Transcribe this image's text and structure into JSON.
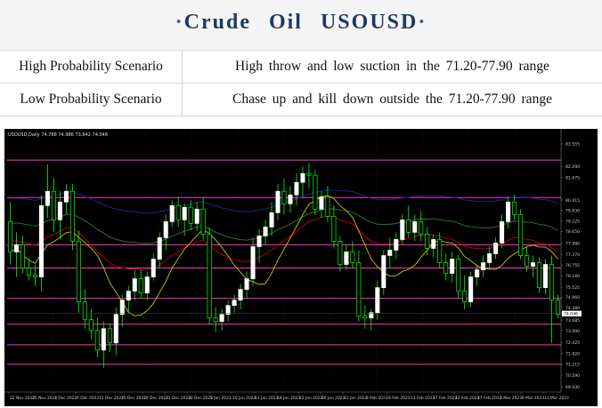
{
  "header": {
    "title": "Crude Oil USOUSD",
    "dot": "·"
  },
  "scenarios": [
    {
      "label": "High Probability Scenario",
      "value": "High throw and low suction in the 71.20-77.90 range"
    },
    {
      "label": "Low Probability Scenario",
      "value": "Chase up and kill down outside the 71.20-77.90 range"
    }
  ],
  "chart_data": {
    "type": "candlestick",
    "symbol_info": "USOUSD,Daily  74.788 74.986 73.842 74.046",
    "current_price": "74.046",
    "colors": {
      "background": "#000000",
      "bull": "#ffffff",
      "bear": "#00ff00",
      "level_lines": "#ff33cc",
      "ma_fast": "#c8c800",
      "ma_mid": "#cc0000",
      "ma_slow": "#2f7a2f",
      "ma_long": "#1a237e"
    },
    "ylim": [
      69.65,
      84.2
    ],
    "y_ticks": [
      "83.555",
      "82.290",
      "81.675",
      "80.415",
      "79.830",
      "79.225",
      "78.650",
      "77.980",
      "77.370",
      "76.755",
      "76.160",
      "75.525",
      "74.960",
      "74.380",
      "73.685",
      "73.090",
      "72.425",
      "71.820",
      "71.215",
      "70.590",
      "69.930"
    ],
    "x_ticks": [
      "22 Nov 2022",
      "25 Nov 2022",
      "1 Dec 2022",
      "6 Dec 2022",
      "11 Dec 2022",
      "15 Dec 2022",
      "20 Dec 2022",
      "23 Dec 2022",
      "30 Dec 2022",
      "5 Jan 2023",
      "10 Jan 2023",
      "13 Jan 2023",
      "18 Jan 2023",
      "23 Jan 2023",
      "26 Jan 2023",
      "31 Jan 2023",
      "3 Feb 2023",
      "8 Feb 2023",
      "13 Feb 2023",
      "17 Feb 2023",
      "22 Feb 2023",
      "27 Feb 2023",
      "2 Mar 2023",
      "8 Mar 2023",
      "13 Mar 2023"
    ],
    "levels": [
      82.65,
      80.55,
      77.9,
      76.6,
      74.9,
      73.45,
      72.3,
      71.2
    ],
    "candles": [
      [
        79.2,
        80.3,
        76.8,
        77.5
      ],
      [
        77.5,
        78.6,
        76.1,
        77.9
      ],
      [
        77.9,
        78.4,
        76.3,
        76.6
      ],
      [
        76.6,
        77.1,
        75.9,
        76.2
      ],
      [
        76.2,
        76.8,
        75.6,
        76.1
      ],
      [
        76.1,
        80.7,
        75.3,
        80.1
      ],
      [
        80.1,
        82.4,
        79.4,
        80.9
      ],
      [
        80.9,
        81.6,
        78.6,
        79.3
      ],
      [
        79.3,
        80.9,
        78.2,
        80.3
      ],
      [
        80.3,
        81.3,
        79.6,
        80.9
      ],
      [
        80.9,
        81.3,
        77.6,
        78.1
      ],
      [
        78.1,
        78.7,
        74.1,
        74.7
      ],
      [
        74.7,
        75.4,
        73.2,
        73.7
      ],
      [
        73.7,
        74.3,
        72.6,
        73.1
      ],
      [
        73.1,
        73.8,
        71.6,
        72.0
      ],
      [
        72.0,
        73.6,
        71.0,
        73.2
      ],
      [
        73.2,
        73.5,
        71.9,
        72.4
      ],
      [
        72.4,
        74.4,
        71.7,
        74.0
      ],
      [
        74.0,
        75.1,
        73.3,
        74.8
      ],
      [
        74.8,
        75.6,
        74.1,
        75.3
      ],
      [
        75.3,
        76.5,
        74.8,
        76.0
      ],
      [
        76.0,
        76.5,
        74.9,
        75.2
      ],
      [
        75.2,
        76.4,
        74.8,
        76.1
      ],
      [
        76.1,
        77.4,
        75.9,
        77.1
      ],
      [
        77.1,
        78.6,
        76.6,
        78.3
      ],
      [
        78.3,
        79.6,
        77.6,
        79.2
      ],
      [
        79.2,
        80.4,
        78.9,
        80.1
      ],
      [
        80.1,
        80.6,
        78.9,
        79.3
      ],
      [
        79.3,
        80.2,
        78.4,
        80.0
      ],
      [
        80.0,
        80.4,
        78.7,
        79.1
      ],
      [
        79.1,
        80.3,
        78.7,
        79.9
      ],
      [
        79.9,
        80.6,
        78.2,
        78.5
      ],
      [
        78.5,
        78.9,
        73.4,
        73.8
      ],
      [
        73.8,
        74.4,
        73.0,
        73.6
      ],
      [
        73.6,
        74.3,
        73.1,
        74.0
      ],
      [
        74.0,
        74.8,
        73.6,
        74.5
      ],
      [
        74.5,
        75.1,
        74.1,
        74.8
      ],
      [
        74.8,
        75.7,
        74.3,
        75.4
      ],
      [
        75.4,
        76.4,
        74.9,
        76.0
      ],
      [
        76.0,
        78.3,
        75.6,
        77.8
      ],
      [
        77.8,
        78.8,
        76.9,
        78.4
      ],
      [
        78.4,
        79.3,
        77.9,
        78.9
      ],
      [
        78.9,
        80.3,
        78.4,
        79.7
      ],
      [
        79.7,
        81.3,
        79.3,
        80.9
      ],
      [
        80.9,
        81.6,
        79.6,
        80.2
      ],
      [
        80.2,
        81.2,
        79.7,
        80.7
      ],
      [
        80.7,
        81.9,
        80.1,
        81.4
      ],
      [
        81.4,
        82.3,
        80.6,
        81.9
      ],
      [
        81.9,
        82.5,
        81.1,
        81.8
      ],
      [
        81.8,
        82.1,
        79.6,
        79.9
      ],
      [
        79.9,
        80.9,
        79.4,
        80.6
      ],
      [
        80.6,
        81.2,
        79.2,
        79.5
      ],
      [
        79.5,
        80.1,
        77.7,
        78.1
      ],
      [
        78.1,
        78.4,
        76.4,
        76.8
      ],
      [
        76.8,
        77.9,
        76.5,
        77.5
      ],
      [
        77.5,
        78.1,
        76.6,
        76.9
      ],
      [
        76.9,
        77.6,
        73.6,
        73.9
      ],
      [
        73.9,
        74.5,
        73.2,
        73.8
      ],
      [
        73.8,
        74.3,
        73.1,
        74.1
      ],
      [
        74.1,
        75.9,
        73.7,
        75.5
      ],
      [
        75.5,
        77.6,
        75.1,
        77.3
      ],
      [
        77.3,
        78.3,
        76.6,
        77.6
      ],
      [
        77.6,
        78.6,
        77.1,
        78.2
      ],
      [
        78.2,
        79.6,
        77.9,
        79.3
      ],
      [
        79.3,
        80.1,
        78.3,
        78.6
      ],
      [
        78.6,
        79.6,
        78.1,
        79.2
      ],
      [
        79.2,
        79.8,
        78.1,
        78.5
      ],
      [
        78.5,
        78.9,
        77.3,
        77.7
      ],
      [
        77.7,
        78.5,
        77.2,
        78.2
      ],
      [
        78.2,
        78.6,
        76.6,
        76.9
      ],
      [
        76.9,
        77.4,
        75.9,
        76.3
      ],
      [
        76.3,
        77.5,
        75.8,
        77.1
      ],
      [
        77.1,
        77.3,
        74.9,
        75.3
      ],
      [
        75.3,
        76.2,
        74.3,
        74.7
      ],
      [
        74.7,
        76.4,
        74.4,
        76.1
      ],
      [
        76.1,
        76.8,
        75.6,
        76.5
      ],
      [
        76.5,
        77.3,
        76.1,
        76.9
      ],
      [
        76.9,
        77.8,
        76.5,
        77.4
      ],
      [
        77.4,
        78.3,
        77.1,
        78.0
      ],
      [
        78.0,
        79.6,
        77.7,
        79.2
      ],
      [
        79.2,
        80.6,
        78.8,
        80.3
      ],
      [
        80.3,
        80.7,
        79.3,
        79.6
      ],
      [
        79.6,
        79.9,
        77.1,
        77.3
      ],
      [
        77.3,
        77.8,
        76.4,
        76.7
      ],
      [
        76.7,
        77.3,
        76.1,
        76.9
      ],
      [
        76.9,
        77.2,
        75.2,
        75.5
      ],
      [
        75.5,
        77.1,
        75.1,
        76.8
      ],
      [
        76.8,
        77.3,
        72.4,
        74.8
      ],
      [
        74.8,
        75.1,
        73.8,
        74.0
      ]
    ]
  }
}
